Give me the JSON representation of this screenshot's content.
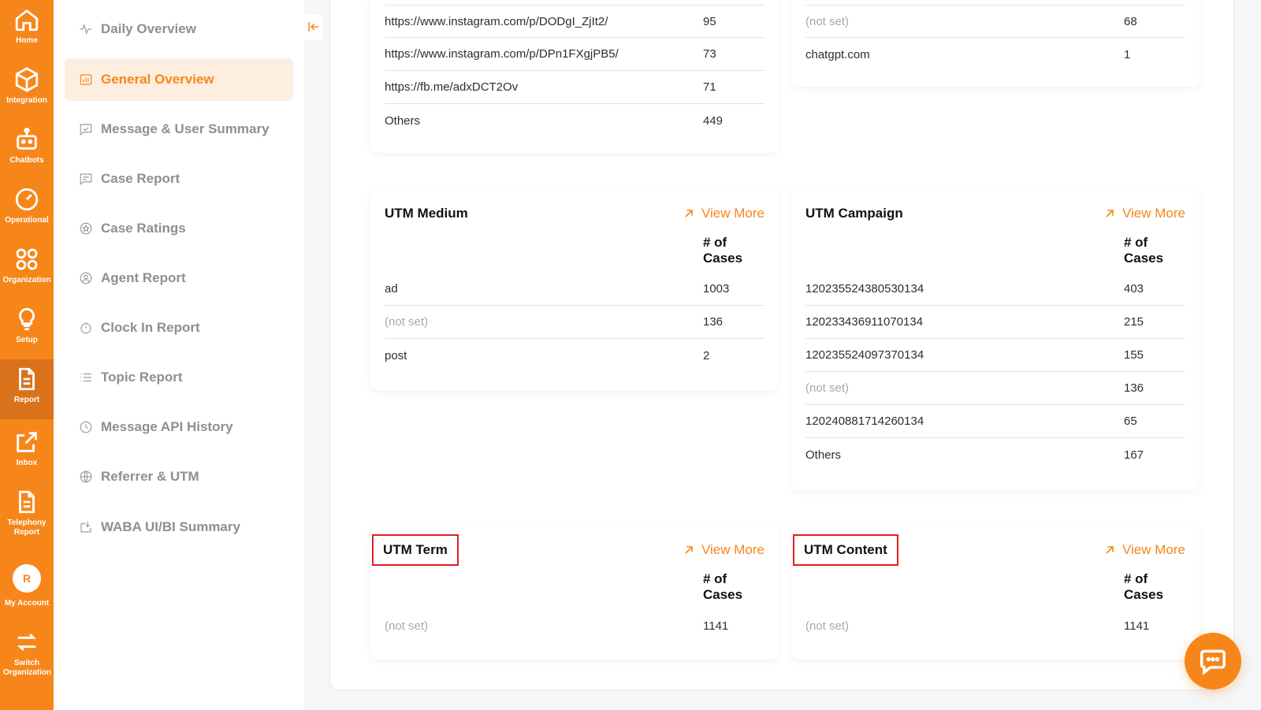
{
  "rail": {
    "items": [
      {
        "label": "Home",
        "icon": "home-icon"
      },
      {
        "label": "Integration",
        "icon": "cube-icon"
      },
      {
        "label": "Chatbots",
        "icon": "robot-icon"
      },
      {
        "label": "Operational",
        "icon": "gauge-icon"
      },
      {
        "label": "Organization",
        "icon": "grid-circles-icon"
      },
      {
        "label": "Setup",
        "icon": "lightbulb-icon"
      },
      {
        "label": "Report",
        "icon": "document-icon"
      },
      {
        "label": "Inbox",
        "icon": "external-link-icon"
      },
      {
        "label": "Telephony Report",
        "icon": "document-icon"
      },
      {
        "label": "My Account",
        "avatar": "R"
      },
      {
        "label": "Switch Organization",
        "icon": "swap-icon"
      }
    ]
  },
  "subnav": {
    "items": [
      {
        "label": "Daily Overview",
        "icon": "pulse-icon"
      },
      {
        "label": "General Overview",
        "icon": "chart-icon"
      },
      {
        "label": "Message & User Summary",
        "icon": "message-check-icon"
      },
      {
        "label": "Case Report",
        "icon": "message-lines-icon"
      },
      {
        "label": "Case Ratings",
        "icon": "star-circle-icon"
      },
      {
        "label": "Agent Report",
        "icon": "user-circle-icon"
      },
      {
        "label": "Clock In Report",
        "icon": "timer-icon"
      },
      {
        "label": "Topic Report",
        "icon": "list-icon"
      },
      {
        "label": "Message API History",
        "icon": "clock-icon"
      },
      {
        "label": "Referrer & UTM",
        "icon": "globe-icon"
      },
      {
        "label": "WABA UI/BI Summary",
        "icon": "inbox-download-icon"
      }
    ]
  },
  "cards": {
    "top_left": {
      "rows": [
        {
          "label": "https://www.instagram.com/p/DODgI_ZjIt2/",
          "value": "95"
        },
        {
          "label": "https://www.instagram.com/p/DPn1FXgjPB5/",
          "value": "73"
        },
        {
          "label": "https://fb.me/adxDCT2Ov",
          "value": "71"
        },
        {
          "label": "Others",
          "value": "449"
        }
      ]
    },
    "top_right": {
      "rows": [
        {
          "label": "(not set)",
          "value": "68"
        },
        {
          "label": "chatgpt.com",
          "value": "1"
        }
      ]
    },
    "utm_medium": {
      "title": "UTM Medium",
      "view_more": "View More",
      "column": "# of Cases",
      "rows": [
        {
          "label": "ad",
          "value": "1003"
        },
        {
          "label": "(not set)",
          "value": "136"
        },
        {
          "label": "post",
          "value": "2"
        }
      ]
    },
    "utm_campaign": {
      "title": "UTM Campaign",
      "view_more": "View More",
      "column": "# of Cases",
      "rows": [
        {
          "label": "120235524380530134",
          "value": "403"
        },
        {
          "label": "120233436911070134",
          "value": "215"
        },
        {
          "label": "120235524097370134",
          "value": "155"
        },
        {
          "label": "(not set)",
          "value": "136"
        },
        {
          "label": "120240881714260134",
          "value": "65"
        },
        {
          "label": "Others",
          "value": "167"
        }
      ]
    },
    "utm_term": {
      "title": "UTM Term",
      "view_more": "View More",
      "column": "# of Cases",
      "rows": [
        {
          "label": "(not set)",
          "value": "1141"
        }
      ]
    },
    "utm_content": {
      "title": "UTM Content",
      "view_more": "View More",
      "column": "# of Cases",
      "rows": [
        {
          "label": "(not set)",
          "value": "1141"
        }
      ]
    }
  },
  "colors": {
    "brand": "#f7861a",
    "highlight_box": "#e02020"
  }
}
